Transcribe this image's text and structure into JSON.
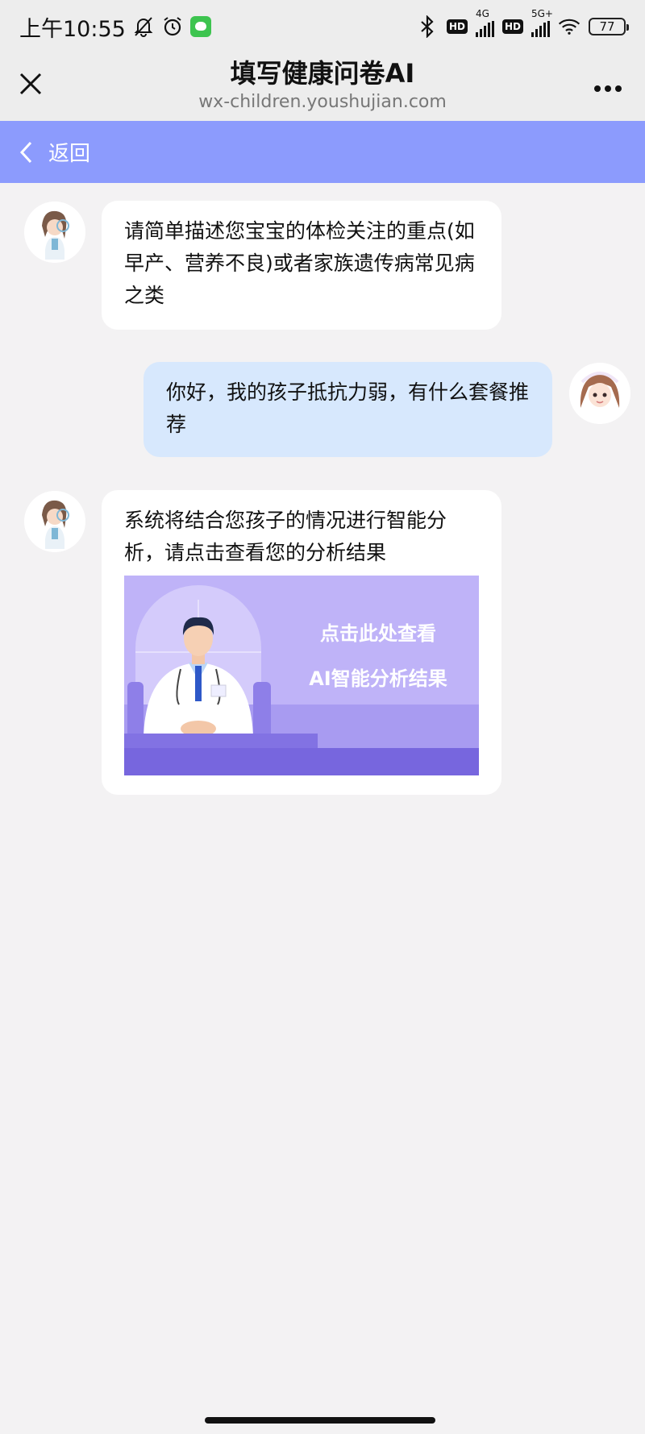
{
  "status_bar": {
    "time": "上午10:55",
    "network_4g": "4G",
    "network_5g": "5G+",
    "hd1": "HD",
    "hd2": "HD",
    "battery": "77"
  },
  "title_bar": {
    "title": "填写健康问卷AI",
    "url": "wx-children.youshujian.com"
  },
  "back_header": {
    "label": "返回"
  },
  "messages": [
    {
      "side": "left",
      "text": "请简单描述您宝宝的体检关注的重点(如早产、营养不良)或者家族遗传病常见病之类"
    },
    {
      "side": "right",
      "text": "你好，我的孩子抵抗力弱，有什么套餐推荐"
    },
    {
      "side": "left",
      "text": "系统将结合您孩子的情况进行智能分析，请点击查看您的分析结果",
      "card": {
        "line1": "点击此处查看",
        "line2": "AI智能分析结果"
      }
    }
  ],
  "colors": {
    "header_accent": "#8c9bfd",
    "user_bubble": "#d7e8fd",
    "card_bg": "#bfb3f8"
  }
}
